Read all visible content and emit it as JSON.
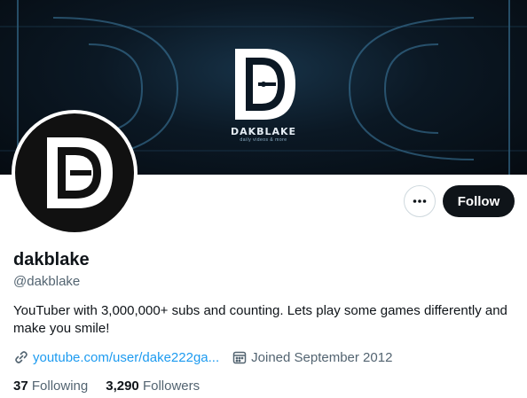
{
  "banner": {
    "brand_name": "DAKBLAKE",
    "brand_tagline": "daily videos & more"
  },
  "profile": {
    "display_name": "dakblake",
    "handle": "@dakblake",
    "bio": "YouTuber with 3,000,000+ subs and counting. Lets play some games differently and make you smile!",
    "website": "youtube.com/user/dake222ga...",
    "joined": "Joined September 2012",
    "following_count": "37",
    "following_label": "Following",
    "followers_count": "3,290",
    "followers_label": "Followers"
  },
  "actions": {
    "more_icon": "more-horizontal-icon",
    "follow_label": "Follow"
  },
  "icons": {
    "website": "link-icon",
    "joined": "calendar-icon"
  },
  "colors": {
    "link": "#1d9bf0",
    "secondary_text": "#536471",
    "primary_text": "#0f1419",
    "follow_button": "#0f1419"
  }
}
